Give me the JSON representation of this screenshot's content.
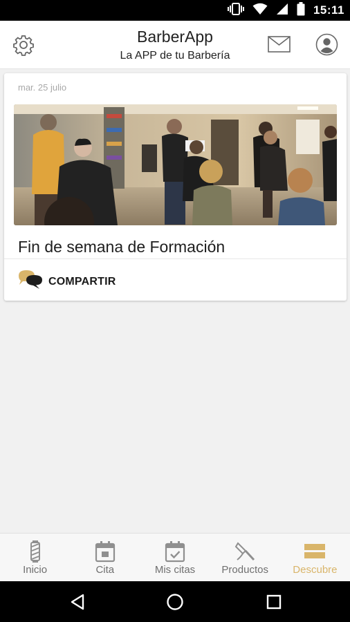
{
  "status_bar": {
    "time": "15:11",
    "icons": [
      "vibrate-icon",
      "wifi-icon",
      "signal-icon",
      "battery-icon"
    ]
  },
  "header": {
    "title": "BarberApp",
    "subtitle": "La APP de tu Barbería",
    "left_icon": "settings-gear-icon",
    "right_icons": [
      "mail-icon",
      "profile-icon"
    ]
  },
  "feed": {
    "cards": [
      {
        "date": "mar. 25 julio",
        "title": "Fin de semana de Formación",
        "share_label": "COMPARTIR",
        "image": "barbershop-training-photo"
      }
    ]
  },
  "bottom_nav": {
    "active": "Descubre",
    "active_color": "#d9b56a",
    "items": [
      {
        "label": "Inicio",
        "icon": "barber-pole-icon"
      },
      {
        "label": "Cita",
        "icon": "calendar-icon"
      },
      {
        "label": "Mis citas",
        "icon": "calendar-check-icon"
      },
      {
        "label": "Productos",
        "icon": "razor-icon"
      },
      {
        "label": "Descubre",
        "icon": "menu-bars-icon"
      }
    ]
  },
  "system_nav": {
    "buttons": [
      "back-icon",
      "home-icon",
      "recents-icon"
    ]
  },
  "colors": {
    "accent": "#d9b56a",
    "background": "#f1f1f1",
    "header_bg": "#ffffff",
    "status_bar_bg": "#000000"
  }
}
